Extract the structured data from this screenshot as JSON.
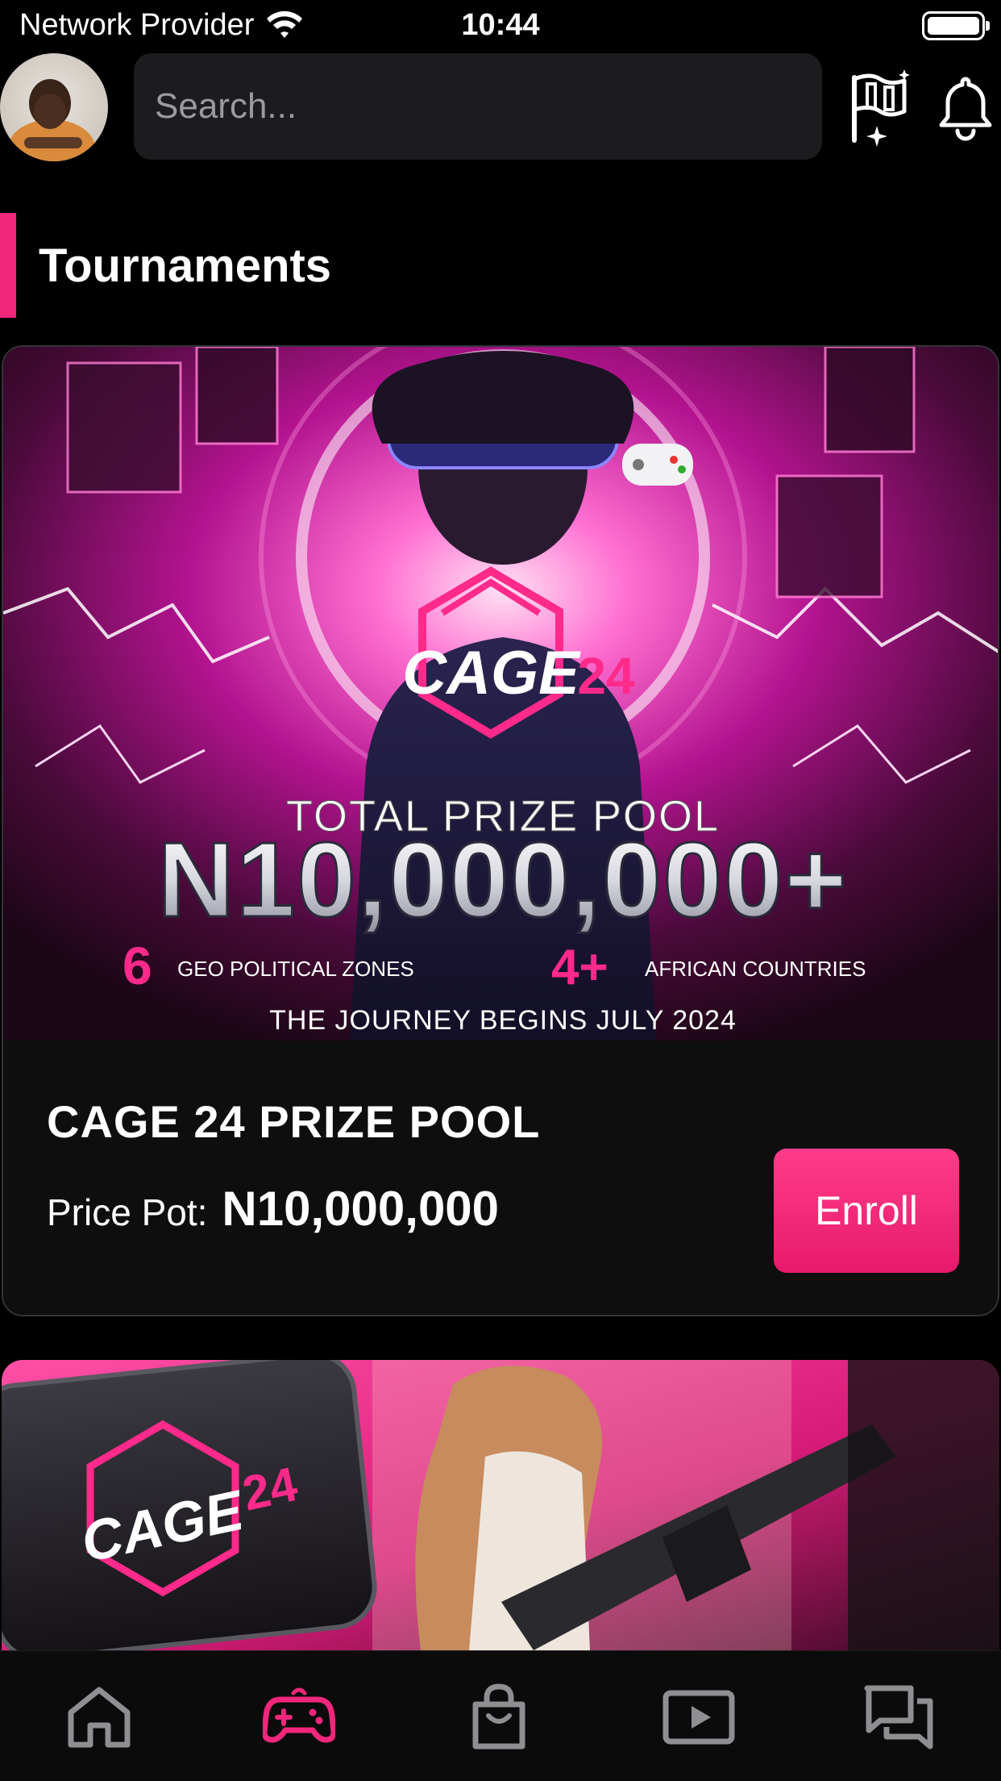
{
  "status_bar": {
    "carrier": "Network Provider",
    "time": "10:44"
  },
  "header": {
    "search_placeholder": "Search..."
  },
  "section": {
    "title": "Tournaments"
  },
  "tournament_card": {
    "banner": {
      "logo_text_a": "CAGE",
      "logo_text_b": "24",
      "headline": "TOTAL PRIZE POOL",
      "amount": "N10,000,000+",
      "stat1_num": "6",
      "stat1_label": "GEO POLITICAL ZONES",
      "stat2_num": "4+",
      "stat2_label": "AFRICAN COUNTRIES",
      "footer": "THE JOURNEY BEGINS JULY 2024"
    },
    "title": "CAGE 24  PRIZE POOL",
    "prize_label": "Price Pot:",
    "prize_value": "N10,000,000",
    "enroll_label": "Enroll"
  },
  "second_card": {
    "logo_text_a": "CAGE",
    "logo_text_b": "24"
  },
  "nav": {
    "items": [
      "home-icon",
      "gamepad-icon",
      "bag-icon",
      "play-icon",
      "chat-icon"
    ],
    "active_index": 1,
    "active_color": "#f0277a",
    "inactive_color": "#8e8e93"
  },
  "colors": {
    "accent": "#f0277a",
    "background": "#000000",
    "card": "#0e0e0e"
  }
}
